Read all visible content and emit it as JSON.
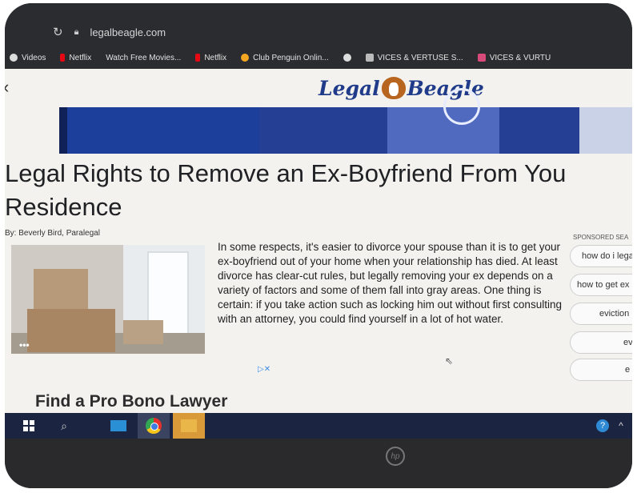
{
  "browser": {
    "url": "legalbeagle.com",
    "bookmarks": [
      {
        "label": "Videos",
        "icon": "circle-icon"
      },
      {
        "label": "Netflix",
        "icon": "netflix-icon"
      },
      {
        "label": "Watch Free Movies...",
        "icon": ""
      },
      {
        "label": "Netflix",
        "icon": "netflix-icon"
      },
      {
        "label": "Club Penguin Onlin...",
        "icon": "penguin-icon"
      },
      {
        "label": "",
        "icon": "globe-icon"
      },
      {
        "label": "VICES & VERTUSE S...",
        "icon": "site-icon"
      },
      {
        "label": "VICES & VURTU",
        "icon": "site-icon"
      }
    ]
  },
  "site": {
    "logo_left": "Legal",
    "logo_right": "Beagle",
    "brand_color": "#1f3b8a"
  },
  "article": {
    "title_line1": "Legal Rights to Remove an Ex-Boyfriend From You",
    "title_line2": "Residence",
    "byline": "By: Beverly Bird, Paralegal",
    "image_menu": "•••",
    "body": "In some respects, it's easier to divorce your spouse than it is to get your ex-boyfriend out of your home when your relationship has died. At least divorce has clear-cut rules, but legally removing your ex depends on a variety of factors and some of them fall into gray areas. One thing is certain: if you take action such as locking him out without first consulting with an attorney, you could find yourself in a lot of hot water.",
    "ad_marker": "▷✕",
    "next_heading": "Find a Pro Bono Lawyer"
  },
  "sponsored": {
    "heading": "SPONSORED SEA",
    "items": [
      "how do i lega",
      "how to get ex",
      "eviction",
      "ev",
      "e"
    ]
  },
  "taskbar": {
    "help_label": "?",
    "chevron": "^"
  },
  "laptop": {
    "brand": "hp"
  }
}
